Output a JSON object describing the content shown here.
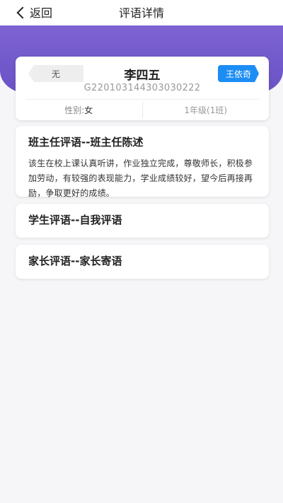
{
  "header": {
    "back_label": "返回",
    "title": "评语详情"
  },
  "student": {
    "status": "无",
    "name": "李四五",
    "teacher": "王依奇",
    "id": "G220103144303030222",
    "gender_label": "性别:",
    "gender": "女",
    "class": "1年级(1班)"
  },
  "comments": [
    {
      "title": "班主任评语--班主任陈述",
      "body": "该生在校上课认真听讲，作业独立完成，尊敬师长，积极参加劳动，有较强的表现能力，学业成绩较好，望今后再接再励，争取更好的成绩。"
    },
    {
      "title": "学生评语--自我评语",
      "body": ""
    },
    {
      "title": "家长评语--家长寄语",
      "body": ""
    }
  ],
  "colors": {
    "header_band": "#6a52c6",
    "teacher_tag": "#1c8df5"
  }
}
